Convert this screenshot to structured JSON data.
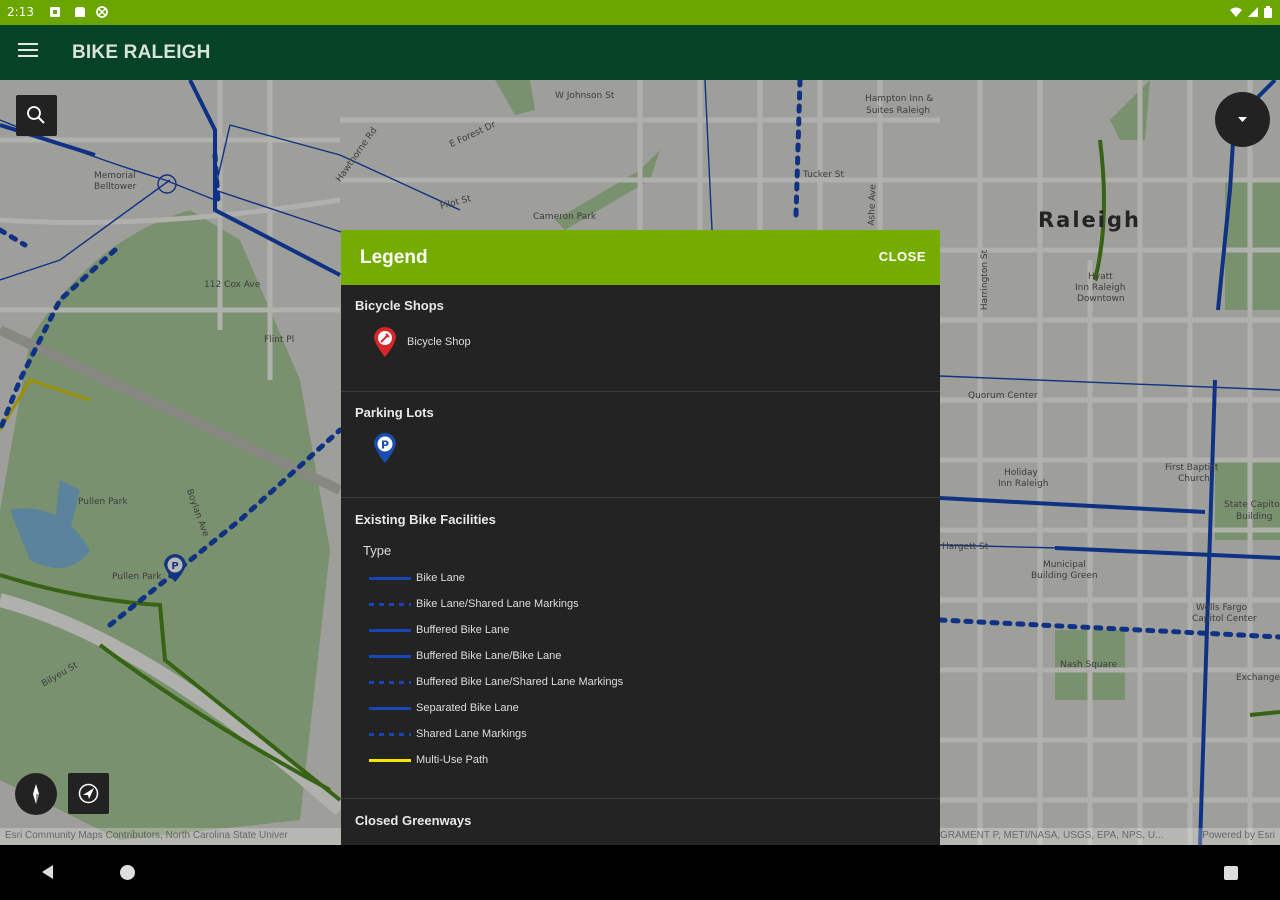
{
  "status_bar": {
    "time": "2:13"
  },
  "app_bar": {
    "title": "BIKE RALEIGH"
  },
  "map": {
    "labels": {
      "city": "Raleigh",
      "w_johnson": "W Johnson St",
      "hampton": "Hampton Inn &",
      "hampton2": "Suites Raleigh",
      "tucker": "Tucker St",
      "e_forest": "E Forest Dr",
      "hawthorne": "Hawthorne Rd",
      "cameron": "Cameron Park",
      "pilot": "Pilot St",
      "cox": "112 Cox Ave",
      "flint": "Flint Pl",
      "memorial": "Memorial",
      "memorial2": "Belltower",
      "pullen_park": "Pullen Park",
      "pullen_park2": "Pullen Park",
      "bilyeu": "Bilyeu St",
      "quorum": "Quorum Center",
      "holiday": "Holiday",
      "holiday2": "Inn Raleigh",
      "first_baptist": "First Baptist",
      "first_baptist2": "Church",
      "state_capitol": "State Capitol",
      "state_capitol2": "Building",
      "municipal": "Municipal",
      "municipal2": "Building Green",
      "wells_fargo": "Wells Fargo",
      "wells_fargo2": "Capitol Center",
      "nash": "Nash Square",
      "exchange": "Exchange",
      "hyatt": "Hyatt",
      "hyatt2": "Inn Raleigh",
      "hyatt3": "Downtown",
      "harrington": "Harrington St",
      "hargett": "Hargett St",
      "fairfield": "Ashe Ave",
      "boylan": "Boylan Ave"
    },
    "attribution_left": "Esri Community Maps Contributors, North Carolina State Univer",
    "attribution_mid": "GRAMENT P, METI/NASA, USGS, EPA, NPS, U...",
    "attribution_right": "Powered by Esri"
  },
  "legend": {
    "title": "Legend",
    "close_label": "CLOSE",
    "sections": {
      "bicycle_shops": {
        "heading": "Bicycle Shops",
        "item": "Bicycle Shop"
      },
      "parking_lots": {
        "heading": "Parking Lots"
      },
      "existing": {
        "heading": "Existing Bike Facilities",
        "sub": "Type",
        "items": [
          {
            "label": "Bike Lane",
            "style": "solid"
          },
          {
            "label": "Bike Lane/Shared Lane Markings",
            "style": "dot"
          },
          {
            "label": "Buffered Bike Lane",
            "style": "solid"
          },
          {
            "label": "Buffered Bike Lane/Bike Lane",
            "style": "solid"
          },
          {
            "label": "Buffered Bike Lane/Shared Lane Markings",
            "style": "dot"
          },
          {
            "label": "Separated Bike Lane",
            "style": "solid"
          },
          {
            "label": "Shared Lane Markings",
            "style": "dot"
          },
          {
            "label": "Multi-Use Path",
            "style": "yellow"
          }
        ]
      },
      "closed": {
        "heading": "Closed Greenways"
      }
    }
  },
  "colors": {
    "status_bar": "#6ba500",
    "app_bar": "#054226",
    "legend_header": "#74ad00",
    "legend_body": "#232323",
    "bike_lane": "#1646b8",
    "multi_use": "#f2e600",
    "shop_pin": "#d8262b",
    "parking_pin": "#1b4cb0"
  }
}
